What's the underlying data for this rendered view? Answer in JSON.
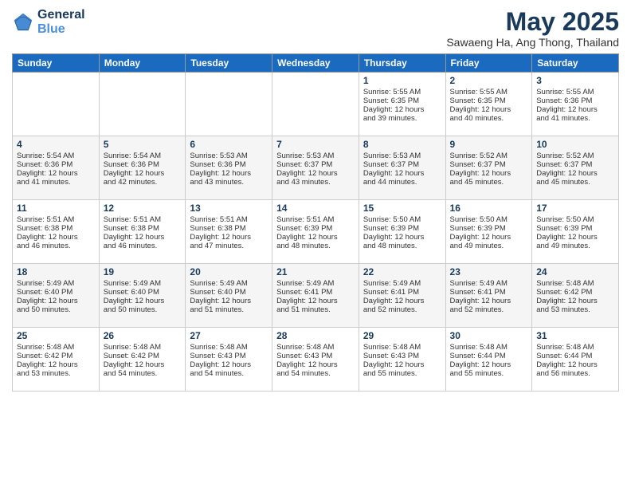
{
  "logo": {
    "general": "General",
    "blue": "Blue"
  },
  "title": "May 2025",
  "location": "Sawaeng Ha, Ang Thong, Thailand",
  "headers": [
    "Sunday",
    "Monday",
    "Tuesday",
    "Wednesday",
    "Thursday",
    "Friday",
    "Saturday"
  ],
  "weeks": [
    [
      {
        "day": "",
        "text": ""
      },
      {
        "day": "",
        "text": ""
      },
      {
        "day": "",
        "text": ""
      },
      {
        "day": "",
        "text": ""
      },
      {
        "day": "1",
        "text": "Sunrise: 5:55 AM\nSunset: 6:35 PM\nDaylight: 12 hours\nand 39 minutes."
      },
      {
        "day": "2",
        "text": "Sunrise: 5:55 AM\nSunset: 6:35 PM\nDaylight: 12 hours\nand 40 minutes."
      },
      {
        "day": "3",
        "text": "Sunrise: 5:55 AM\nSunset: 6:36 PM\nDaylight: 12 hours\nand 41 minutes."
      }
    ],
    [
      {
        "day": "4",
        "text": "Sunrise: 5:54 AM\nSunset: 6:36 PM\nDaylight: 12 hours\nand 41 minutes."
      },
      {
        "day": "5",
        "text": "Sunrise: 5:54 AM\nSunset: 6:36 PM\nDaylight: 12 hours\nand 42 minutes."
      },
      {
        "day": "6",
        "text": "Sunrise: 5:53 AM\nSunset: 6:36 PM\nDaylight: 12 hours\nand 43 minutes."
      },
      {
        "day": "7",
        "text": "Sunrise: 5:53 AM\nSunset: 6:37 PM\nDaylight: 12 hours\nand 43 minutes."
      },
      {
        "day": "8",
        "text": "Sunrise: 5:53 AM\nSunset: 6:37 PM\nDaylight: 12 hours\nand 44 minutes."
      },
      {
        "day": "9",
        "text": "Sunrise: 5:52 AM\nSunset: 6:37 PM\nDaylight: 12 hours\nand 45 minutes."
      },
      {
        "day": "10",
        "text": "Sunrise: 5:52 AM\nSunset: 6:37 PM\nDaylight: 12 hours\nand 45 minutes."
      }
    ],
    [
      {
        "day": "11",
        "text": "Sunrise: 5:51 AM\nSunset: 6:38 PM\nDaylight: 12 hours\nand 46 minutes."
      },
      {
        "day": "12",
        "text": "Sunrise: 5:51 AM\nSunset: 6:38 PM\nDaylight: 12 hours\nand 46 minutes."
      },
      {
        "day": "13",
        "text": "Sunrise: 5:51 AM\nSunset: 6:38 PM\nDaylight: 12 hours\nand 47 minutes."
      },
      {
        "day": "14",
        "text": "Sunrise: 5:51 AM\nSunset: 6:39 PM\nDaylight: 12 hours\nand 48 minutes."
      },
      {
        "day": "15",
        "text": "Sunrise: 5:50 AM\nSunset: 6:39 PM\nDaylight: 12 hours\nand 48 minutes."
      },
      {
        "day": "16",
        "text": "Sunrise: 5:50 AM\nSunset: 6:39 PM\nDaylight: 12 hours\nand 49 minutes."
      },
      {
        "day": "17",
        "text": "Sunrise: 5:50 AM\nSunset: 6:39 PM\nDaylight: 12 hours\nand 49 minutes."
      }
    ],
    [
      {
        "day": "18",
        "text": "Sunrise: 5:49 AM\nSunset: 6:40 PM\nDaylight: 12 hours\nand 50 minutes."
      },
      {
        "day": "19",
        "text": "Sunrise: 5:49 AM\nSunset: 6:40 PM\nDaylight: 12 hours\nand 50 minutes."
      },
      {
        "day": "20",
        "text": "Sunrise: 5:49 AM\nSunset: 6:40 PM\nDaylight: 12 hours\nand 51 minutes."
      },
      {
        "day": "21",
        "text": "Sunrise: 5:49 AM\nSunset: 6:41 PM\nDaylight: 12 hours\nand 51 minutes."
      },
      {
        "day": "22",
        "text": "Sunrise: 5:49 AM\nSunset: 6:41 PM\nDaylight: 12 hours\nand 52 minutes."
      },
      {
        "day": "23",
        "text": "Sunrise: 5:49 AM\nSunset: 6:41 PM\nDaylight: 12 hours\nand 52 minutes."
      },
      {
        "day": "24",
        "text": "Sunrise: 5:48 AM\nSunset: 6:42 PM\nDaylight: 12 hours\nand 53 minutes."
      }
    ],
    [
      {
        "day": "25",
        "text": "Sunrise: 5:48 AM\nSunset: 6:42 PM\nDaylight: 12 hours\nand 53 minutes."
      },
      {
        "day": "26",
        "text": "Sunrise: 5:48 AM\nSunset: 6:42 PM\nDaylight: 12 hours\nand 54 minutes."
      },
      {
        "day": "27",
        "text": "Sunrise: 5:48 AM\nSunset: 6:43 PM\nDaylight: 12 hours\nand 54 minutes."
      },
      {
        "day": "28",
        "text": "Sunrise: 5:48 AM\nSunset: 6:43 PM\nDaylight: 12 hours\nand 54 minutes."
      },
      {
        "day": "29",
        "text": "Sunrise: 5:48 AM\nSunset: 6:43 PM\nDaylight: 12 hours\nand 55 minutes."
      },
      {
        "day": "30",
        "text": "Sunrise: 5:48 AM\nSunset: 6:44 PM\nDaylight: 12 hours\nand 55 minutes."
      },
      {
        "day": "31",
        "text": "Sunrise: 5:48 AM\nSunset: 6:44 PM\nDaylight: 12 hours\nand 56 minutes."
      }
    ]
  ]
}
